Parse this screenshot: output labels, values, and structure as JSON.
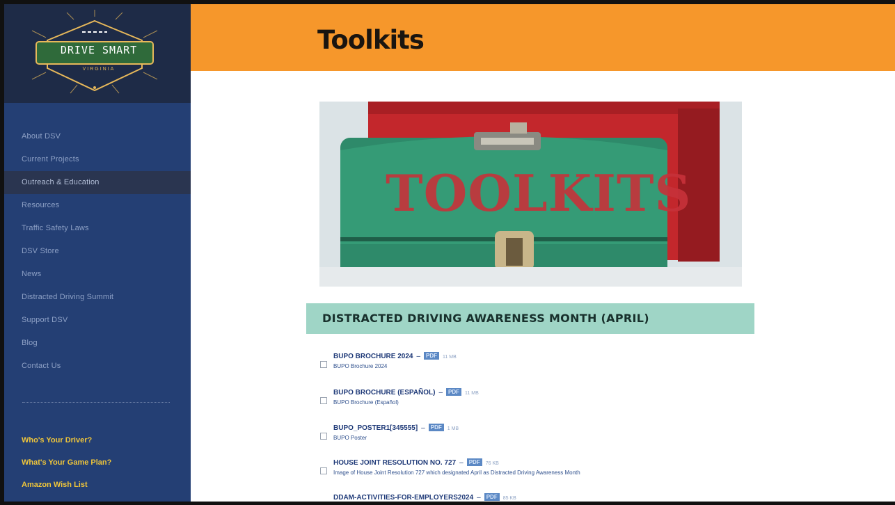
{
  "logo": {
    "text": "DRIVE SMART",
    "subtext": "VIRGINIA"
  },
  "nav": {
    "items": [
      {
        "label": "About DSV"
      },
      {
        "label": "Current Projects"
      },
      {
        "label": "Outreach & Education",
        "active": true
      },
      {
        "label": "Resources"
      },
      {
        "label": "Traffic Safety Laws"
      },
      {
        "label": "DSV Store"
      },
      {
        "label": "News"
      },
      {
        "label": "Distracted Driving Summit"
      },
      {
        "label": "Support DSV"
      },
      {
        "label": "Blog"
      },
      {
        "label": "Contact Us"
      }
    ]
  },
  "footer_links": [
    {
      "label": "Who's Your Driver?"
    },
    {
      "label": "What's Your Game Plan?"
    },
    {
      "label": "Amazon Wish List"
    }
  ],
  "header": {
    "title": "Toolkits"
  },
  "hero": {
    "word": "TOOLKITS"
  },
  "section": {
    "title": "DISTRACTED DRIVING AWARENESS MONTH (APRIL)"
  },
  "documents": [
    {
      "title": "BUPO BROCHURE 2024",
      "badge": "PDF",
      "size": "11 MB",
      "desc": "BUPO Brochure 2024"
    },
    {
      "title": "BUPO BROCHURE (ESPAÑOL)",
      "badge": "PDF",
      "size": "11 MB",
      "desc": "BUPO Brochure (Español)"
    },
    {
      "title": "BUPO_POSTER1[345555]",
      "badge": "PDF",
      "size": "1 MB",
      "desc": "BUPO Poster"
    },
    {
      "title": "HOUSE JOINT RESOLUTION NO. 727",
      "badge": "PDF",
      "size": "76 KB",
      "desc": "Image of House Joint Resolution 727 which designated April as Distracted Driving Awareness Month"
    },
    {
      "title": "DDAM-ACTIVITIES-FOR-EMPLOYERS2024",
      "badge": "PDF",
      "size": "85 KB",
      "desc": ""
    }
  ],
  "colors": {
    "sidebar": "#243f74",
    "header": "#f6972b",
    "section_band": "#9fd5c6",
    "accent_links": "#f0c63a"
  }
}
